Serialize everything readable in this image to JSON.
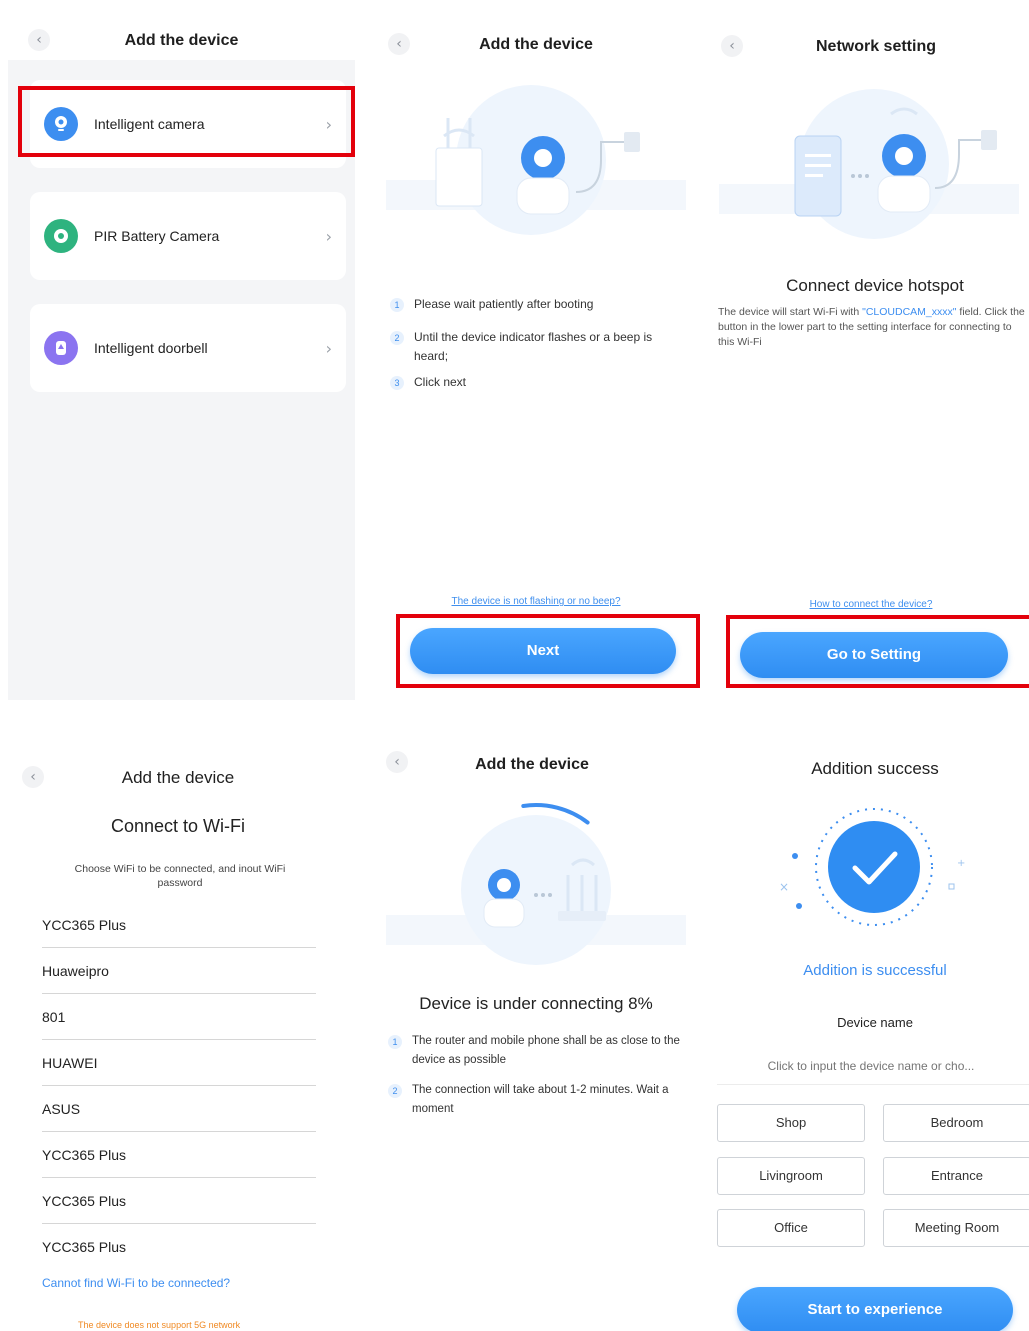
{
  "panel1": {
    "title": "Add the device",
    "items": [
      {
        "label": "Intelligent camera",
        "icon": "camera-icon",
        "color": "#3d8ef0"
      },
      {
        "label": "PIR Battery Camera",
        "icon": "pir-camera-icon",
        "color": "#2eb37f"
      },
      {
        "label": "Intelligent doorbell",
        "icon": "doorbell-icon",
        "color": "#8b74f0"
      }
    ]
  },
  "panel2": {
    "title": "Add the device",
    "steps": [
      {
        "num": "1",
        "text": "Please wait patiently after booting"
      },
      {
        "num": "2",
        "text": "Until the device indicator flashes or a beep is heard;"
      },
      {
        "num": "3",
        "text": "Click next"
      }
    ],
    "help_link": "The device is not flashing or no beep?",
    "next_button": "Next"
  },
  "panel3": {
    "title": "Network setting",
    "heading": "Connect device hotspot",
    "desc_before": "The device will start Wi-Fi with ",
    "desc_highlight": "\"CLOUDCAM_xxxx\"",
    "desc_after": " field. Click the button in the lower part to the setting interface for connecting to this Wi-Fi",
    "help_link": "How to connect the device?",
    "button": "Go to Setting"
  },
  "panel4": {
    "title": "Add the device",
    "heading": "Connect to Wi-Fi",
    "subtitle": "Choose WiFi to be connected, and inout WiFi password",
    "networks": [
      "YCC365 Plus",
      "Huaweipro",
      "801",
      "HUAWEI",
      "ASUS",
      "YCC365 Plus",
      "YCC365 Plus",
      "YCC365 Plus"
    ],
    "cannot_find": "Cannot find Wi-Fi to be connected?",
    "note": "The device does not support 5G network"
  },
  "panel5": {
    "title": "Add the device",
    "status": "Device is under connecting 8%",
    "progress_percent": 8,
    "steps": [
      {
        "num": "1",
        "text": "The router and mobile phone shall be as close to the device as possible"
      },
      {
        "num": "2",
        "text": "The connection will take about 1-2 minutes. Wait a moment"
      }
    ]
  },
  "panel6": {
    "title": "Addition success",
    "success_text": "Addition is successful",
    "device_name_label": "Device name",
    "name_placeholder": "Click to input the device name or cho...",
    "rooms": [
      "Shop",
      "Bedroom",
      "Livingroom",
      "Entrance",
      "Office",
      "Meeting Room"
    ],
    "start_button": "Start to experience"
  },
  "colors": {
    "accent": "#3d8ef0",
    "highlight": "#e3000b",
    "orange_note": "#f08a24"
  }
}
